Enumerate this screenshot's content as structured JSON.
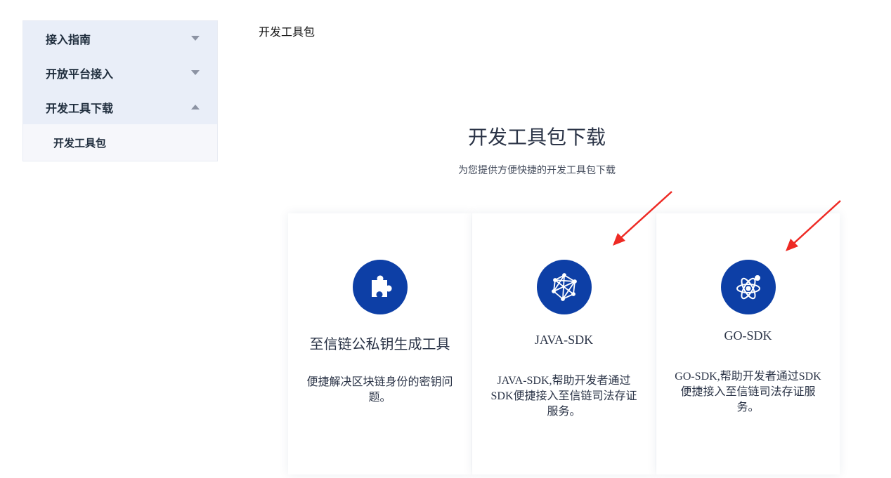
{
  "sidebar": {
    "items": [
      {
        "label": "接入指南",
        "expanded": false
      },
      {
        "label": "开放平台接入",
        "expanded": false
      },
      {
        "label": "开发工具下载",
        "expanded": true
      }
    ],
    "subitems": [
      {
        "label": "开发工具包"
      }
    ]
  },
  "breadcrumb": "开发工具包",
  "hero": {
    "title": "开发工具包下载",
    "subtitle": "为您提供方便快捷的开发工具包下载"
  },
  "cards": [
    {
      "icon": "puzzle-icon",
      "title": "至信链公私钥生成工具",
      "desc": "便捷解决区块链身份的密钥问题。"
    },
    {
      "icon": "network-icon",
      "title": "JAVA-SDK",
      "desc": "JAVA-SDK,帮助开发者通过SDK便捷接入至信链司法存证服务。"
    },
    {
      "icon": "atom-icon",
      "title": "GO-SDK",
      "desc": "GO-SDK,帮助开发者通过SDK便捷接入至信链司法存证服务。"
    }
  ],
  "colors": {
    "accent": "#0d3fa6",
    "sidebar_bg": "#e9eef8",
    "annotation_arrow": "#ee2a24"
  }
}
